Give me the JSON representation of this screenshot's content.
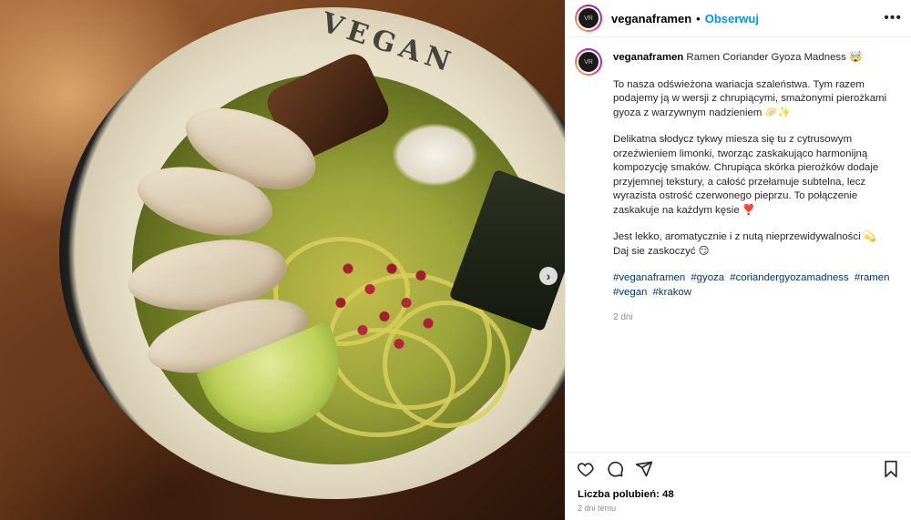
{
  "post": {
    "username": "veganaframen",
    "follow_label": "Obserwuj",
    "separator": "•",
    "more_label": "•••",
    "avatar_text": "VR",
    "caption_title": "Ramen Coriander Gyoza Madness 🤯",
    "paragraph1": "To nasza odświeżona wariacja szaleństwa. Tym razem podajemy ją w wersji z chrupiącymi, smażonymi pierożkami gyoza z warzywnym nadzieniem 🥟✨",
    "paragraph2": "Delikatna słodycz tykwy miesza się tu z cytrusowym orzeźwieniem limonki, tworząc zaskakująco harmonijną kompozycję smaków. Chrupiąca skórka pierożków dodaje przyjemnej tekstury, a całość przełamuje subtelna, lecz wyrazista ostrość czerwonego pieprzu. To połączenie zaskakuje na każdym kęsie ❣️",
    "paragraph3": "Jest lekko, aromatycznie i z nutą nieprzewidywalności 💫\nDaj sie zaskoczyć 😏",
    "hashtags": [
      "#veganaframen",
      "#gyoza",
      "#coriandergyozamadness",
      "#ramen",
      "#vegan",
      "#krakow"
    ],
    "caption_time": "2 dni",
    "likes_label": "Liczba polubień: 48",
    "posted_label": "2 dni temu"
  },
  "photo": {
    "bowl_text": "VEGAN",
    "next_icon": "›"
  },
  "icons": {
    "like": "heart-icon",
    "comment": "comment-icon",
    "share": "share-icon",
    "save": "bookmark-icon"
  }
}
